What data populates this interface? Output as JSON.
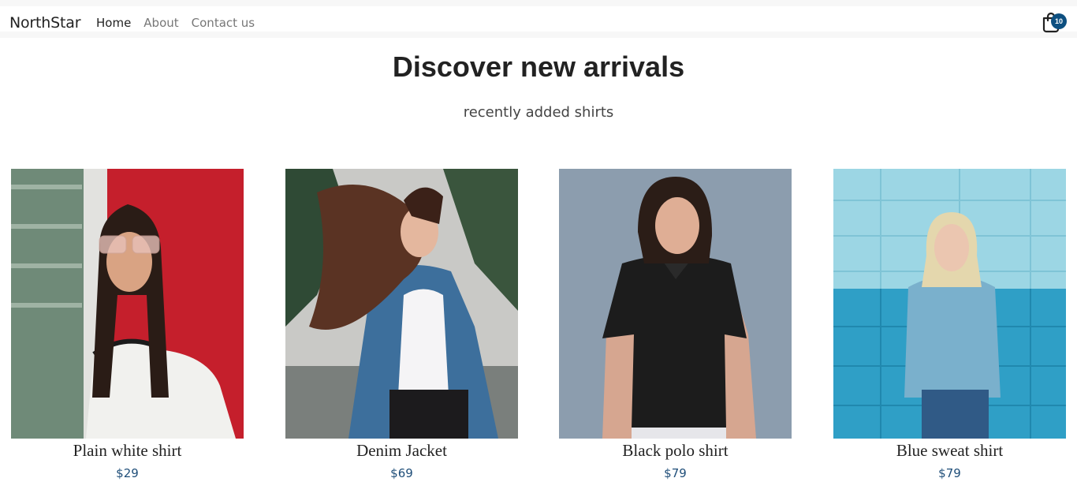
{
  "nav": {
    "brand": "NorthStar",
    "links": [
      {
        "label": "Home",
        "active": true
      },
      {
        "label": "About",
        "active": false
      },
      {
        "label": "Contact us",
        "active": false
      }
    ],
    "cart_count": "10",
    "cart_icon": "shopping-bag-icon"
  },
  "hero": {
    "title": "Discover new arrivals",
    "subtitle": "recently added shirts"
  },
  "products": [
    {
      "name": "Plain white shirt",
      "price": "$29"
    },
    {
      "name": "Denim Jacket",
      "price": "$69"
    },
    {
      "name": "Black polo shirt",
      "price": "$79"
    },
    {
      "name": "Blue sweat shirt",
      "price": "$79"
    }
  ],
  "colors": {
    "accent": "#0d4f80",
    "price": "#1f4e79"
  }
}
